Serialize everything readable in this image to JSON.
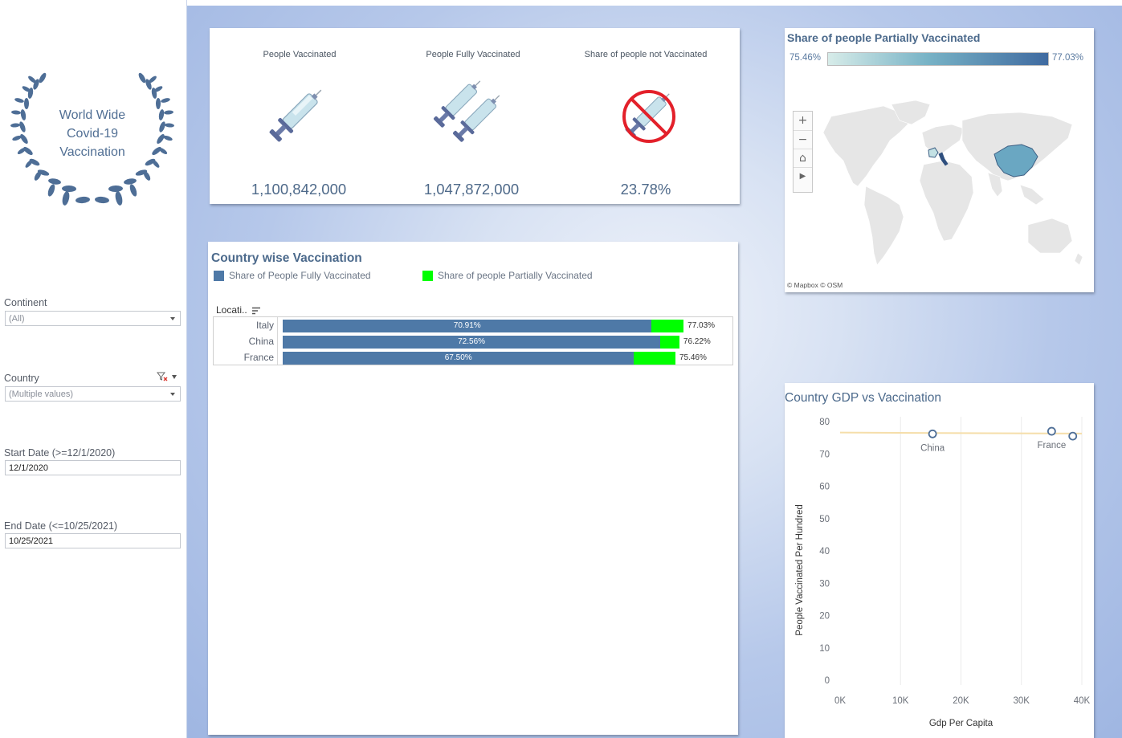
{
  "logo": {
    "lines": [
      "World Wide",
      "Covid-19",
      "Vaccination"
    ]
  },
  "filters": {
    "continent": {
      "label": "Continent",
      "value": "(All)"
    },
    "country": {
      "label": "Country",
      "value": "(Multiple values)"
    },
    "start_date": {
      "label": "Start Date (>=12/1/2020)",
      "value": "12/1/2020"
    },
    "end_date": {
      "label": "End Date (<=10/25/2021)",
      "value": "10/25/2021"
    }
  },
  "kpis": [
    {
      "label": "People Vaccinated",
      "value": "1,100,842,000",
      "icon": "syringe-icon"
    },
    {
      "label": "People Fully Vaccinated",
      "value": "1,047,872,000",
      "icon": "double-syringe-icon"
    },
    {
      "label": "Share of people not Vaccinated",
      "value": "23.78%",
      "icon": "no-syringe-icon"
    }
  ],
  "country_wise": {
    "title": "Country wise Vaccination",
    "legend": [
      {
        "label": "Share of People Fully Vaccinated",
        "color": "#4e79a7"
      },
      {
        "label": "Share of people Partially Vaccinated",
        "color": "#00ff00"
      }
    ],
    "column_header": "Locati..",
    "rows": [
      {
        "country": "Italy",
        "fully": 70.91,
        "fully_label": "70.91%",
        "total": 77.03,
        "total_label": "77.03%"
      },
      {
        "country": "China",
        "fully": 72.56,
        "fully_label": "72.56%",
        "total": 76.22,
        "total_label": "76.22%"
      },
      {
        "country": "France",
        "fully": 67.5,
        "fully_label": "67.50%",
        "total": 75.46,
        "total_label": "75.46%"
      }
    ]
  },
  "map": {
    "title": "Share of people Partially Vaccinated",
    "min_label": "75.46%",
    "max_label": "77.03%",
    "controls": [
      "+",
      "−",
      "⌂",
      "▶"
    ],
    "attribution": "© Mapbox  © OSM"
  },
  "chart_data": {
    "type": "scatter",
    "title": "Country GDP vs Vaccination",
    "xlabel": "Gdp Per Capita",
    "ylabel": "People Vaccinated Per Hundred",
    "xlim": [
      0,
      40000
    ],
    "ylim": [
      0,
      80
    ],
    "x_ticks": [
      "0K",
      "10K",
      "20K",
      "30K",
      "40K"
    ],
    "y_ticks": [
      "0",
      "10",
      "20",
      "30",
      "40",
      "50",
      "60",
      "70",
      "80"
    ],
    "points": [
      {
        "label": "China",
        "x": 15300,
        "y": 76.2
      },
      {
        "label": "France",
        "x": 35000,
        "y": 77.0
      },
      {
        "label": "",
        "x": 38500,
        "y": 75.5
      }
    ],
    "trend_line": {
      "y_start": 76.6,
      "y_end": 76.3,
      "color": "#f5deaa"
    },
    "grid": true
  }
}
